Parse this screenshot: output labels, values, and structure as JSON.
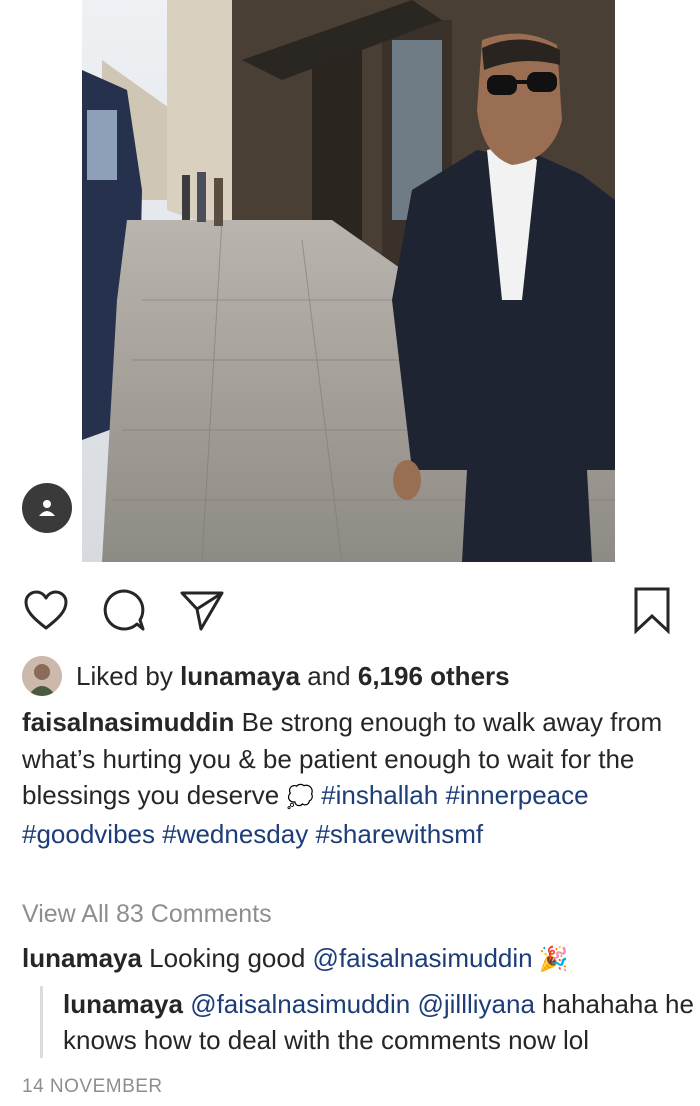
{
  "post": {
    "photo_alt": "",
    "tag_icon": "person-icon"
  },
  "actions": {
    "like_icon": "heart-icon",
    "comment_icon": "comment-icon",
    "share_icon": "send-icon",
    "save_icon": "bookmark-icon"
  },
  "likes": {
    "prefix": "Liked by ",
    "user": "lunamaya",
    "middle": " and ",
    "count": "6,196 others"
  },
  "caption": {
    "username": "faisalnasimuddin",
    "text": " Be strong enough to walk away from what’s hurting you & be patient enough to wait for the blessings you deserve ",
    "emoji": "💭",
    "hashtags": [
      "#inshallah",
      "#innerpeace",
      "#goodvibes",
      "#wednesday",
      "#sharewithsmf"
    ]
  },
  "comments": {
    "view_all": "View All 83 Comments",
    "items": [
      {
        "username": "lunamaya",
        "text": " Looking good ",
        "mention": "@faisalnasimuddin",
        "emoji": "🎉"
      }
    ],
    "reply": {
      "username": "lunamaya",
      "mention1": "@faisalnasimuddin",
      "mention2": "@jillliyana",
      "text": " hahahaha he knows how to deal with the comments now lol"
    }
  },
  "date": "14 NOVEMBER"
}
